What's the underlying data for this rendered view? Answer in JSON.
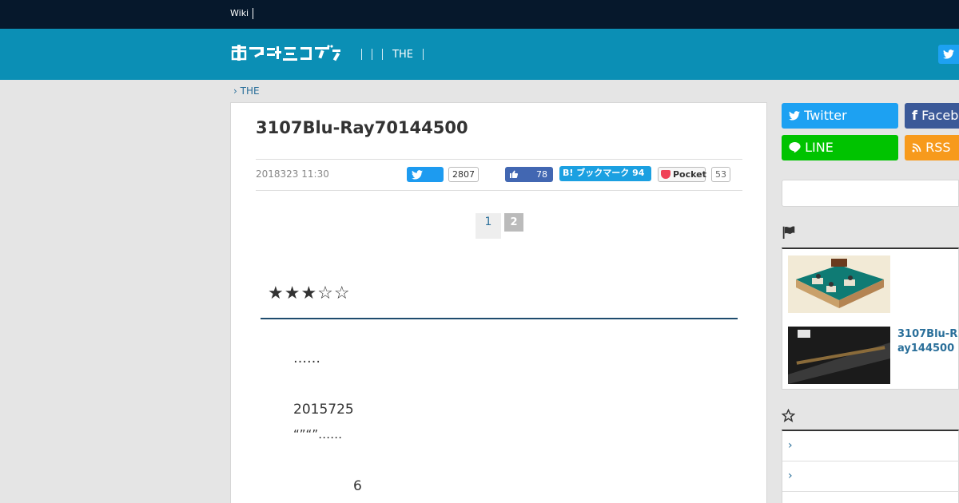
{
  "topbar": {
    "wiki_label": "Wiki"
  },
  "header": {
    "logo_text": "電ファミニコゲーマー",
    "nav_item": "THE"
  },
  "breadcrumb": {
    "item": "THE"
  },
  "article": {
    "title": "3107Blu-Ray70144500",
    "date": "2018323 11:30",
    "twitter_count": "2807",
    "like_count": "78",
    "hatena_label": "ブックマーク 94",
    "pocket_label": "Pocket",
    "pocket_count": "53",
    "pager": [
      "1",
      "2"
    ],
    "stars": "★★★☆☆",
    "paragraphs": [
      "……",
      "2015725",
      "“”“”……",
      "6"
    ]
  },
  "sidebar": {
    "twitter_label": "Twitter",
    "facebook_label": "Faceb",
    "line_label": "LINE",
    "rss_label": "RSS",
    "ranking_items": [
      {
        "title": ""
      },
      {
        "title": "3107Blu-Ray144500"
      }
    ]
  },
  "colors": {
    "topbar": "#06182c",
    "header": "#0b8fb5",
    "twitter": "#1da1f2",
    "facebook": "#3b5998",
    "line": "#00c300",
    "rss": "#f79a1c",
    "link": "#2a6f9a"
  }
}
